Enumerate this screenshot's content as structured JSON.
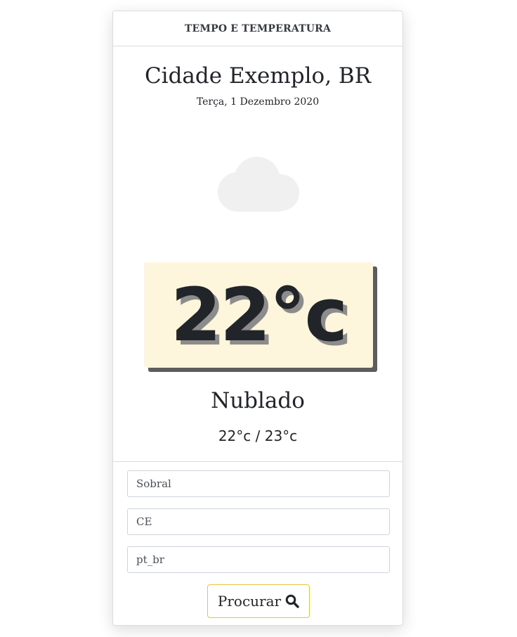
{
  "header": {
    "title": "TEMPO E TEMPERATURA"
  },
  "location": {
    "city": "Cidade Exemplo, BR",
    "date": "Terça, 1 Dezembro 2020"
  },
  "weather": {
    "icon": "cloud-icon",
    "temperature": "22°c",
    "condition": "Nublado",
    "range": "22°c / 23°c"
  },
  "form": {
    "city_value": "Sobral",
    "state_value": "CE",
    "lang_value": "pt_br",
    "search_label": "Procurar",
    "search_icon": "search-icon"
  },
  "colors": {
    "temp_box_bg": "#fdf5dc",
    "button_border": "#e9c440",
    "cloud": "#f0f0f0"
  }
}
